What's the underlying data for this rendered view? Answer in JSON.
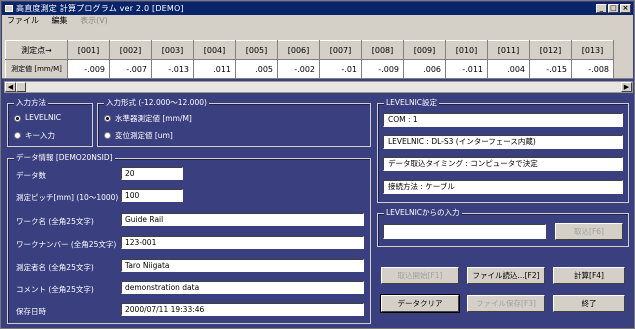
{
  "window": {
    "title": "高直度測定 計算プログラム ver 2.0 [DEMO]"
  },
  "menu": [
    {
      "label": "ファイル",
      "enabled": true
    },
    {
      "label": "編集",
      "enabled": true
    },
    {
      "label": "表示(V)",
      "enabled": false
    }
  ],
  "grid": {
    "row_headers": [
      "測定点→",
      "測定値 [mm/M]"
    ],
    "columns": [
      "[001]",
      "[002]",
      "[003]",
      "[004]",
      "[005]",
      "[006]",
      "[007]",
      "[008]",
      "[009]",
      "[010]",
      "[011]",
      "[012]",
      "[013]"
    ],
    "values": [
      "-.009",
      "-.007",
      "-.013",
      ".011",
      ".005",
      "-.002",
      "-.01",
      "-.009",
      ".006",
      "-.011",
      ".004",
      "-.015",
      "-.008"
    ]
  },
  "input_method": {
    "label": "入力方法",
    "options": [
      "LEVELNIC",
      "キー入力"
    ],
    "selected": 0
  },
  "input_format": {
    "label": "入力形式 (-12.000～12.000)",
    "options": [
      "水準器測定値 [mm/M]",
      "変位測定値 [um]"
    ],
    "selected": 0
  },
  "data_info": {
    "label": "データ情報 [DEMO20NSID]",
    "fields": [
      {
        "label": "データ数",
        "value": "20"
      },
      {
        "label": "測定ピッチ[mm] (10～1000)",
        "value": "100"
      },
      {
        "label": "ワーク名 (全角25文字)",
        "value": "Guide Rail"
      },
      {
        "label": "ワークナンバー (全角25文字)",
        "value": "123-001"
      },
      {
        "label": "測定者名 (全角25文字)",
        "value": "Taro Niigata"
      },
      {
        "label": "コメント (全角25文字)",
        "value": "demonstration data"
      },
      {
        "label": "保存日時",
        "value": "2000/07/11   19:33:46"
      }
    ]
  },
  "levelnic_settings": {
    "label": "LEVELNIC設定",
    "lines": [
      "COM : 1",
      "LEVELNIC : DL-S3 (インターフェース内蔵)",
      "データ取込タイミング : コンピュータで決定",
      "接続方法 : ケーブル"
    ]
  },
  "levelnic_input": {
    "label": "LEVELNICからの入力",
    "value": "",
    "button": "取込[F6]"
  },
  "buttons": {
    "capture_start": "取込開始[F1]",
    "file_load": "ファイル読込...[F2]",
    "calculate": "計算[F4]",
    "data_clear": "データクリア",
    "file_save": "ファイル保存[F3]",
    "exit": "終了"
  }
}
